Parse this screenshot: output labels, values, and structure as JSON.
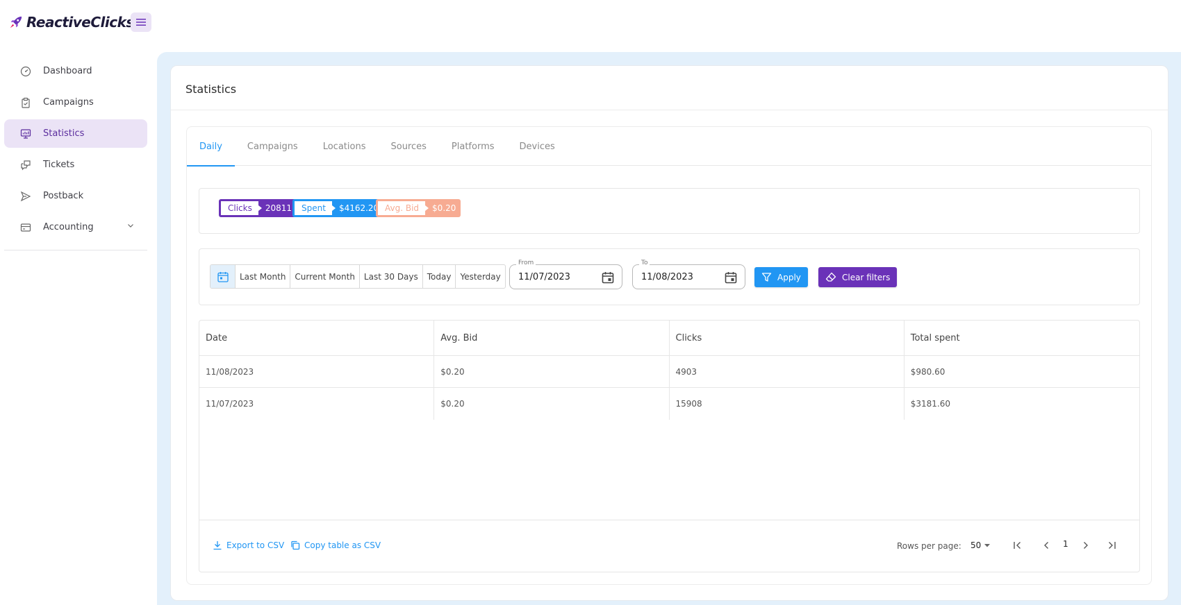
{
  "app": {
    "name": "ReactiveClicks"
  },
  "sidebar": {
    "items": [
      {
        "label": "Dashboard",
        "icon": "dashboard-gauge-icon"
      },
      {
        "label": "Campaigns",
        "icon": "clipboard-icon"
      },
      {
        "label": "Statistics",
        "icon": "monitor-chart-icon",
        "active": true
      },
      {
        "label": "Tickets",
        "icon": "chat-bubbles-icon"
      },
      {
        "label": "Postback",
        "icon": "send-plane-icon"
      },
      {
        "label": "Accounting",
        "icon": "credit-card-icon",
        "expandable": true
      }
    ]
  },
  "page": {
    "title": "Statistics"
  },
  "tabs": [
    "Daily",
    "Campaigns",
    "Locations",
    "Sources",
    "Platforms",
    "Devices"
  ],
  "active_tab": "Daily",
  "summary": {
    "clicks": {
      "label": "Clicks",
      "value": "20811",
      "color": "#6a32b8"
    },
    "spent": {
      "label": "Spent",
      "value": "$4162.20",
      "color": "#2196f3"
    },
    "avg_bid": {
      "label": "Avg. Bid",
      "value": "$0.20",
      "color": "#f7ab92"
    }
  },
  "filters": {
    "presets": [
      "Last Month",
      "Current Month",
      "Last 30 Days",
      "Today",
      "Yesterday"
    ],
    "from": {
      "label": "From",
      "value": "11/07/2023"
    },
    "to": {
      "label": "To",
      "value": "11/08/2023"
    },
    "apply_label": "Apply",
    "clear_label": "Clear filters"
  },
  "table": {
    "columns": [
      "Date",
      "Avg. Bid",
      "Clicks",
      "Total spent"
    ],
    "rows": [
      [
        "11/08/2023",
        "$0.20",
        "4903",
        "$980.60"
      ],
      [
        "11/07/2023",
        "$0.20",
        "15908",
        "$3181.60"
      ]
    ]
  },
  "footer": {
    "export_label": "Export to CSV",
    "copy_label": "Copy table as CSV",
    "rows_per_page_label": "Rows per page:",
    "rows_per_page_value": "50",
    "current_page": "1"
  },
  "colors": {
    "accent": "#2196f3",
    "brand": "#6a32b8",
    "main_bg": "#e3f0fb"
  }
}
